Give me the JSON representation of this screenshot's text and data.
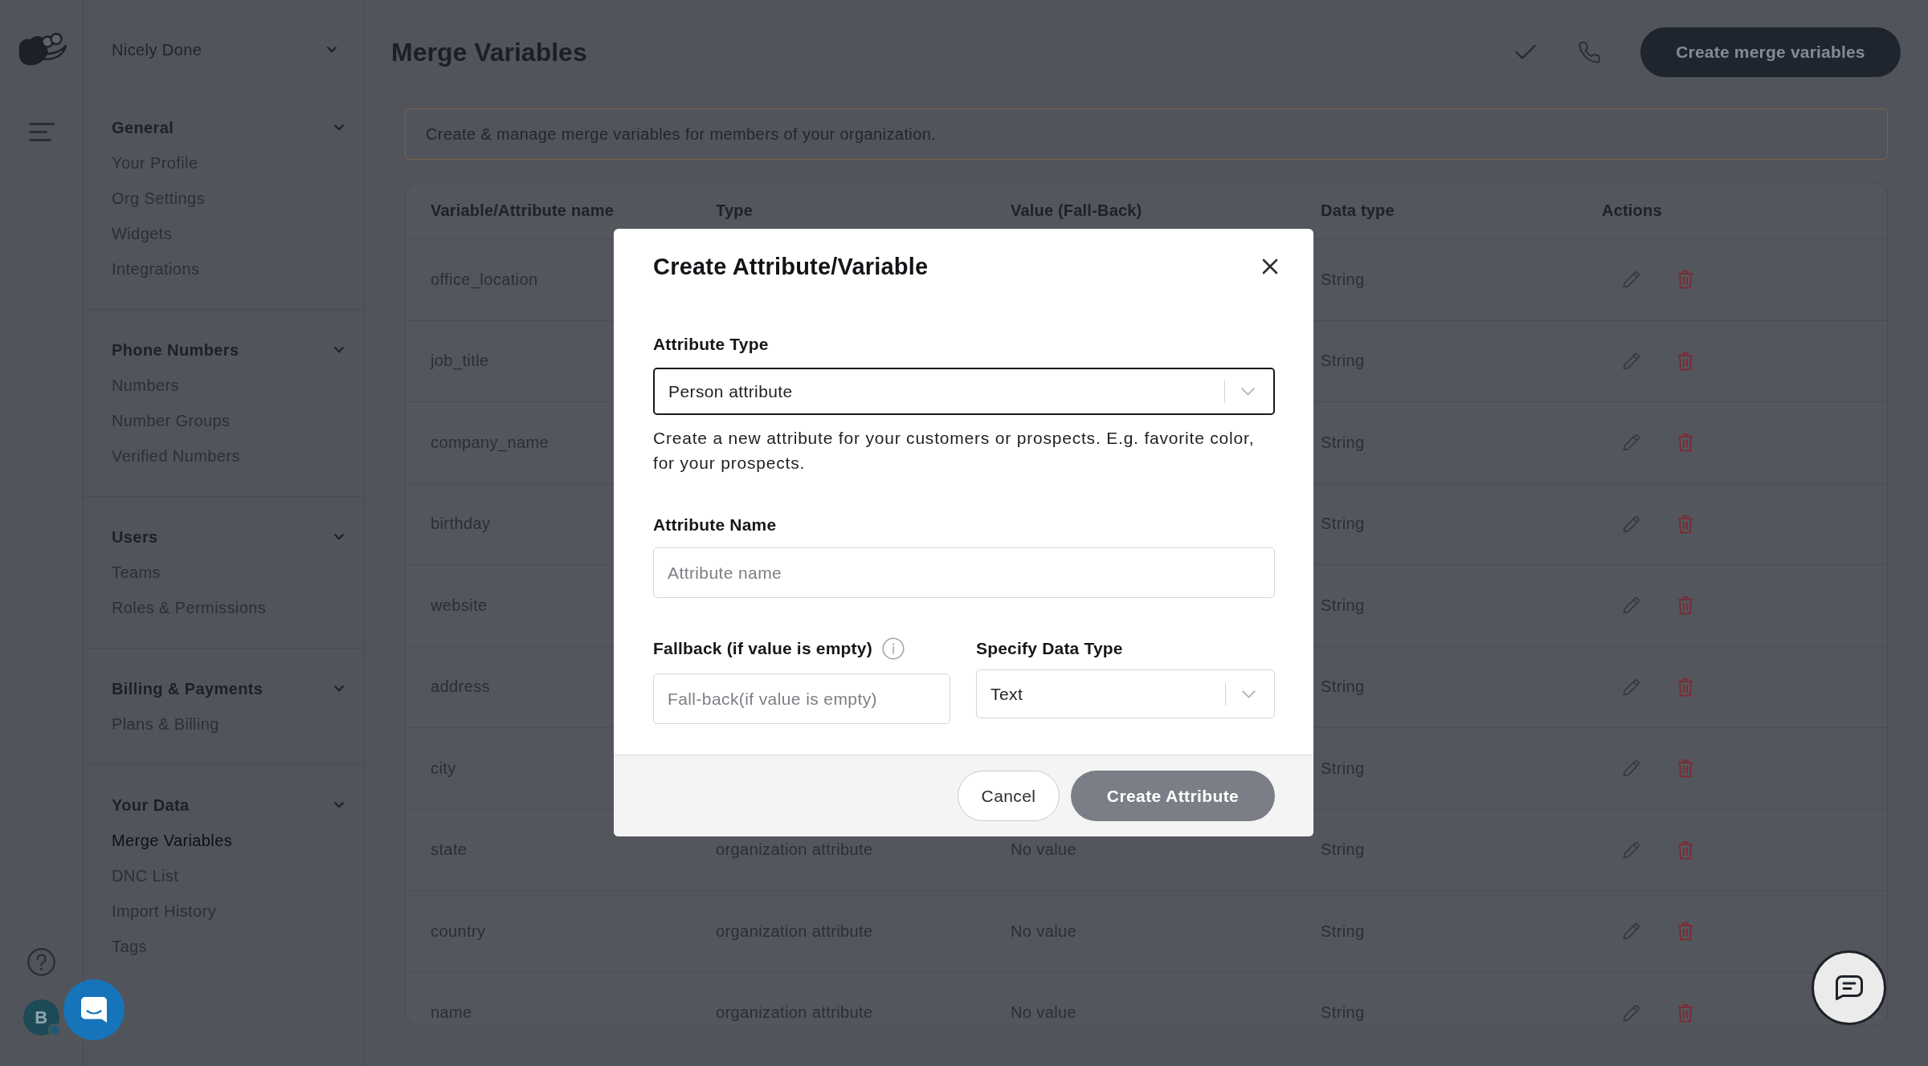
{
  "rail": {
    "avatar": {
      "initial": "B"
    }
  },
  "sidebar": {
    "org": "Nicely Done",
    "sections": [
      {
        "title": "General",
        "items": [
          {
            "label": "Your Profile",
            "selected": false
          },
          {
            "label": "Org Settings",
            "selected": false
          },
          {
            "label": "Widgets",
            "selected": false
          },
          {
            "label": "Integrations",
            "selected": false
          }
        ]
      },
      {
        "title": "Phone Numbers",
        "items": [
          {
            "label": "Numbers",
            "selected": false
          },
          {
            "label": "Number Groups",
            "selected": false
          },
          {
            "label": "Verified Numbers",
            "selected": false
          }
        ]
      },
      {
        "title": "Users",
        "items": [
          {
            "label": "Teams",
            "selected": false
          },
          {
            "label": "Roles & Permissions",
            "selected": false
          }
        ]
      },
      {
        "title": "Billing & Payments",
        "items": [
          {
            "label": "Plans & Billing",
            "selected": false
          }
        ]
      },
      {
        "title": "Your Data",
        "items": [
          {
            "label": "Merge Variables",
            "selected": true
          },
          {
            "label": "DNC List",
            "selected": false
          },
          {
            "label": "Import History",
            "selected": false
          },
          {
            "label": "Tags",
            "selected": false
          }
        ]
      }
    ]
  },
  "header": {
    "title": "Merge Variables",
    "button": "Create merge variables"
  },
  "banner": {
    "text": "Create & manage merge variables for members of your organization."
  },
  "table": {
    "columns": [
      "Variable/Attribute name",
      "Type",
      "Value (Fall-Back)",
      "Data type",
      "Actions"
    ],
    "rows": [
      {
        "name": "office_location",
        "data_type": "String"
      },
      {
        "name": "job_title",
        "data_type": "String"
      },
      {
        "name": "company_name",
        "data_type": "String"
      },
      {
        "name": "birthday",
        "data_type": "String"
      },
      {
        "name": "website",
        "data_type": "String"
      },
      {
        "name": "address",
        "data_type": "String"
      },
      {
        "name": "city",
        "data_type": "String"
      },
      {
        "name": "state",
        "type": "organization attribute",
        "value": "No value",
        "data_type": "String"
      },
      {
        "name": "country",
        "type": "organization attribute",
        "value": "No value",
        "data_type": "String"
      },
      {
        "name": "name",
        "type": "organization attribute",
        "value": "No value",
        "data_type": "String"
      }
    ]
  },
  "modal": {
    "title": "Create Attribute/Variable",
    "attribute_type": {
      "label": "Attribute Type",
      "value": "Person attribute",
      "focused": true
    },
    "help_text": "Create a new attribute for your customers or prospects. E.g. favorite color, for your prospects.",
    "attribute_name": {
      "label": "Attribute Name",
      "placeholder": "Attribute name",
      "focused": false
    },
    "fallback": {
      "label": "Fallback (if value is empty)",
      "placeholder": "Fall-back(if value is empty)",
      "focused": false
    },
    "data_type": {
      "label": "Specify Data Type",
      "value": "Text",
      "focused": false
    },
    "buttons": [
      {
        "label": "Cancel",
        "kind": "secondary",
        "disabled": false
      },
      {
        "label": "Create Attribute",
        "kind": "primary",
        "disabled": true
      }
    ]
  }
}
